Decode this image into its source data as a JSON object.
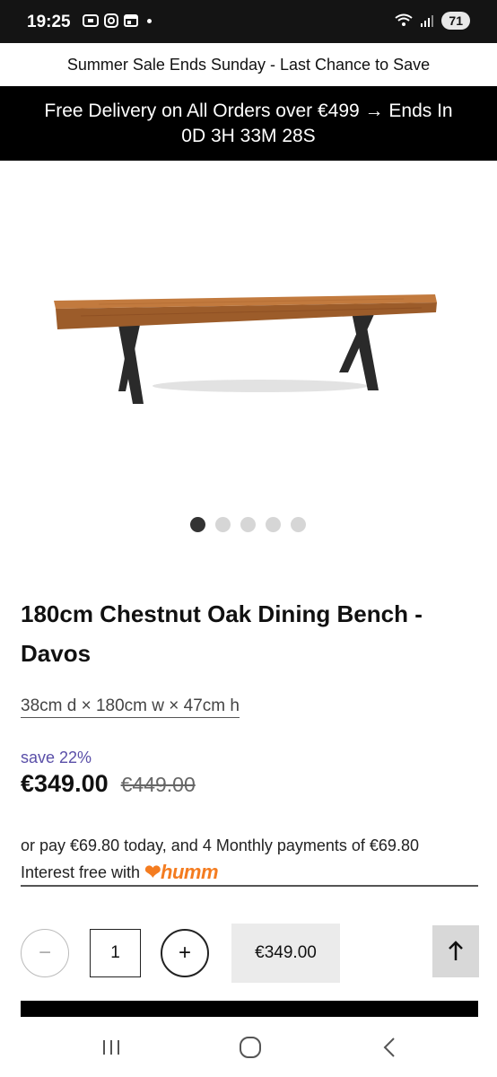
{
  "status_bar": {
    "time": "19:25",
    "battery": "71"
  },
  "banners": {
    "sale": "Summer Sale Ends Sunday - Last Chance to Save",
    "delivery_line1": "Free Delivery on All Orders over €499 → Ends In",
    "delivery_line2": "0D 3H 33M 28S"
  },
  "carousel": {
    "slide_count": 5,
    "active_index": 0
  },
  "product": {
    "title": "180cm Chestnut Oak Dining Bench - Davos",
    "dimensions": "38cm d × 180cm w × 47cm h",
    "save_label": "save 22%",
    "price": "€349.00",
    "was_price": "€449.00"
  },
  "finance": {
    "line1": "or pay €69.80 today, and 4 Monthly payments of €69.80",
    "line2": "Interest free with",
    "logo_text": "humm"
  },
  "purchase": {
    "minus_symbol": "−",
    "quantity": "1",
    "plus_symbol": "+",
    "add_price": "€349.00"
  },
  "colors": {
    "accent_save": "#5a4fa8",
    "humm_orange": "#f47c20"
  }
}
